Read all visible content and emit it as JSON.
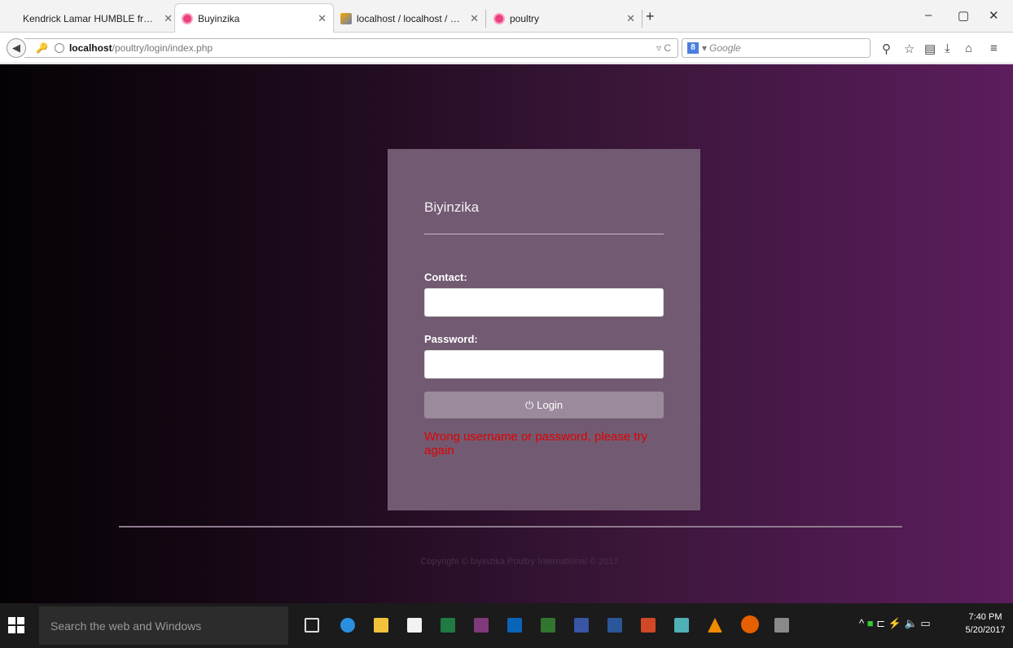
{
  "browser": {
    "tabs": [
      {
        "title": "Kendrick Lamar HUMBLE free ...",
        "favicon": "none"
      },
      {
        "title": "Buyinzika",
        "favicon": "pink-app-icon",
        "active": true
      },
      {
        "title": "localhost / localhost / pim...",
        "favicon": "phpmyadmin-icon"
      },
      {
        "title": "poultry",
        "favicon": "pink-app-icon"
      }
    ],
    "new_tab": "+",
    "window_controls": {
      "minimize": "–",
      "restore": "▢",
      "close": "✕"
    },
    "url_host": "localhost",
    "url_path": "/poultry/login/index.php",
    "url_suffix": "▿ C",
    "search_engine": "Google",
    "search_placeholder": "Google"
  },
  "login": {
    "brand": "Biyinzika",
    "contact_label": "Contact:",
    "contact_value": "",
    "password_label": "Password:",
    "password_value": "",
    "login_button": "Login",
    "error": "Wrong username or password, please try again"
  },
  "footer": {
    "copyright": "Copyright © biyinzika Poultry International © 2017"
  },
  "taskbar": {
    "search_placeholder": "Search the web and Windows",
    "time": "7:40 PM",
    "date": "5/20/2017"
  },
  "colors": {
    "background_gradient": [
      "#050205",
      "#5c1d5d"
    ],
    "panel": "#725b72",
    "error": "#e00000",
    "button": "#9a8a9b"
  }
}
